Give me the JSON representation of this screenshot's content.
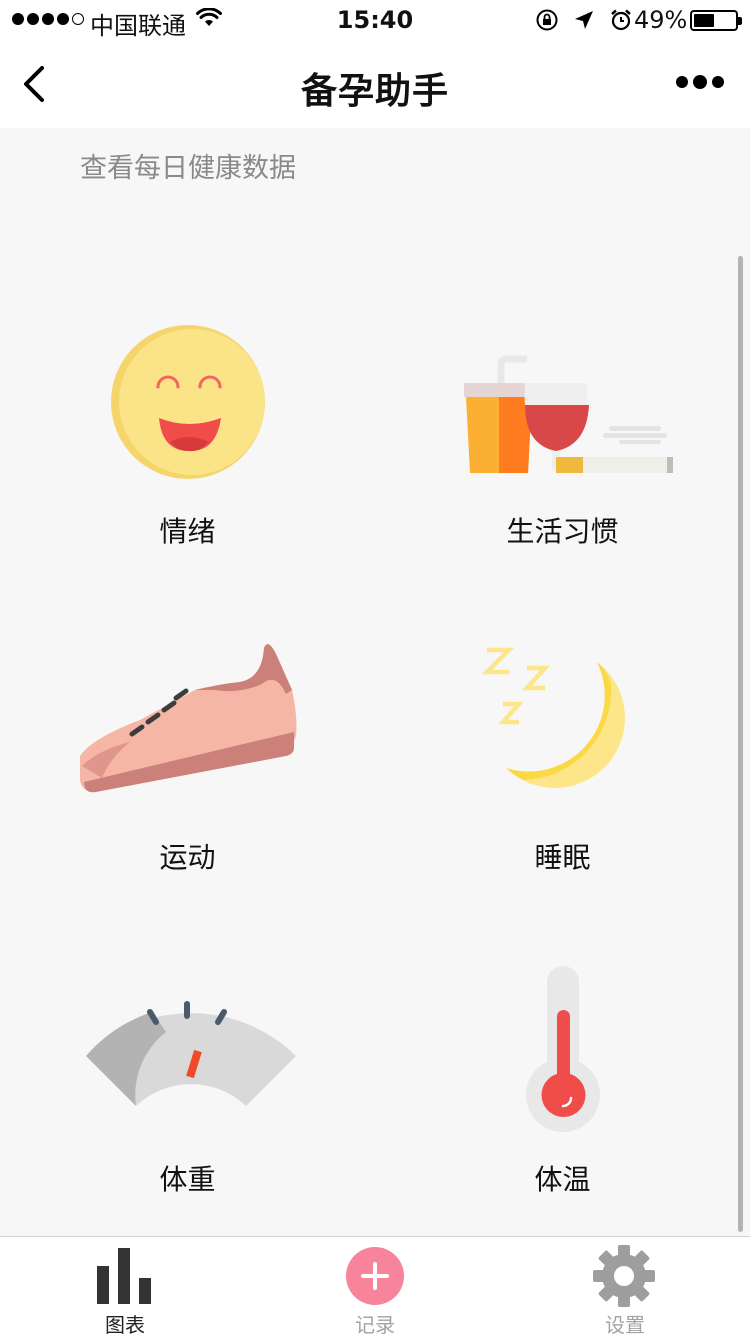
{
  "status_bar": {
    "carrier": "中国联通",
    "time": "15:40",
    "battery": "49%",
    "battery_level": 0.49,
    "icons": [
      "signal-icon",
      "wifi-icon",
      "orientation-lock-icon",
      "location-arrow-icon",
      "alarm-icon",
      "battery-icon"
    ]
  },
  "nav": {
    "title": "备孕助手",
    "back_icon": "chevron-left-icon",
    "more_icon": "more-dots-icon"
  },
  "content": {
    "subtitle": "查看每日健康数据",
    "items": [
      {
        "label": "情绪",
        "icon": "smiley-face-icon"
      },
      {
        "label": "生活习惯",
        "icon": "drinks-cigarette-icon"
      },
      {
        "label": "运动",
        "icon": "sneaker-icon"
      },
      {
        "label": "睡眠",
        "icon": "moon-zzz-icon"
      },
      {
        "label": "体重",
        "icon": "scale-gauge-icon"
      },
      {
        "label": "体温",
        "icon": "thermometer-icon"
      }
    ]
  },
  "tab_bar": {
    "tabs": [
      {
        "label": "图表",
        "icon": "bar-chart-icon",
        "active": true
      },
      {
        "label": "记录",
        "icon": "plus-circle-icon",
        "active": false
      },
      {
        "label": "设置",
        "icon": "gear-icon",
        "active": false
      }
    ],
    "accent_color": "#f7849b"
  },
  "colors": {
    "background": "#f7f7f7",
    "subtitle": "#8a8a8a"
  }
}
